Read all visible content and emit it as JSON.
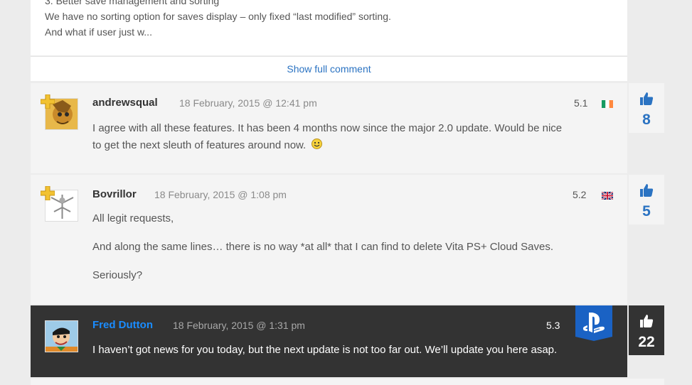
{
  "top_comment": {
    "lines": [
      "3. Better save management and sorting",
      "We have no sorting option for saves display – only fixed “last modified” sorting.",
      "And what if user just w..."
    ],
    "show_full_label": "Show full comment"
  },
  "comments": [
    {
      "author": "andrewsqual",
      "date": "18 February, 2015 @ 12:41 pm",
      "number": "5.1",
      "flag": "ireland-flag",
      "paragraphs": [
        "I agree with all these features. It has been 4 months now since the major 2.0 update. Would be nice",
        "to get the next sleuth of features around now."
      ],
      "votes": "8"
    },
    {
      "author": "Bovrillor",
      "date": "18 February, 2015 @ 1:08 pm",
      "number": "5.2",
      "flag": "uk-flag",
      "paragraphs": [
        "All legit requests,",
        "And along the same lines… there is no way *at all* that I can find to delete Vita PS+ Cloud Saves.",
        "Seriously?"
      ],
      "votes": "5"
    },
    {
      "author": "Fred Dutton",
      "date": "18 February, 2015 @ 1:31 pm",
      "number": "5.3",
      "flag": "playstation-staff-badge",
      "paragraphs": [
        "I haven’t got news for you today, but the next update is not too far out. We’ll update you here asap."
      ],
      "votes": "22"
    }
  ],
  "colors": {
    "link_blue": "#2b73c2",
    "staff_name": "#1a8cff",
    "staff_bg": "#333333",
    "card_bg": "#f4f4f4",
    "page_bg": "#ececec"
  }
}
